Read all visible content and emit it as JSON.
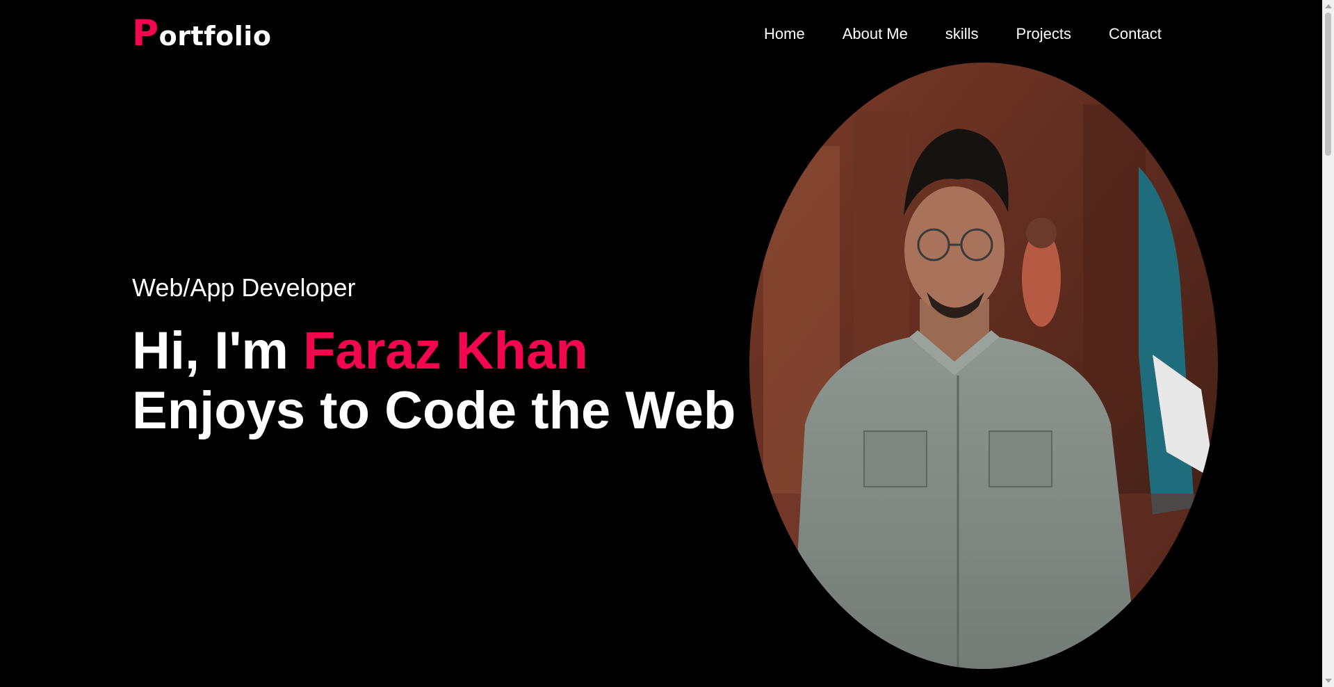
{
  "logo": {
    "first_letter": "P",
    "rest": "ortfolio"
  },
  "nav": {
    "items": [
      {
        "label": "Home"
      },
      {
        "label": "About Me"
      },
      {
        "label": "skills"
      },
      {
        "label": "Projects"
      },
      {
        "label": "Contact"
      }
    ]
  },
  "hero": {
    "role": "Web/App Developer",
    "greeting": "Hi, I'm ",
    "name": "Faraz Khan",
    "tagline": "Enjoys to Code the Web"
  },
  "colors": {
    "accent": "#f2074f",
    "background": "#000000",
    "text": "#ffffff"
  },
  "portrait": {
    "icon": "profile-photo"
  }
}
